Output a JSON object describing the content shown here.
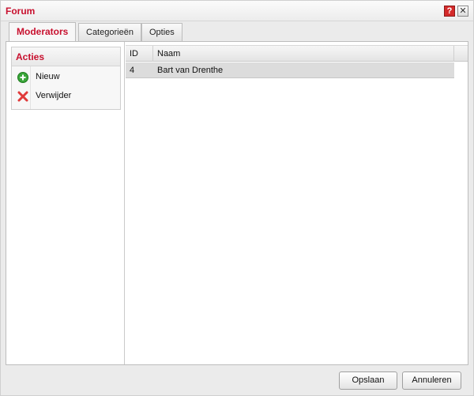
{
  "window": {
    "title": "Forum"
  },
  "titlebar": {
    "help_glyph": "?",
    "close_glyph": "✕"
  },
  "tabs": [
    {
      "label": "Moderators",
      "active": true
    },
    {
      "label": "Categorieën",
      "active": false
    },
    {
      "label": "Opties",
      "active": false
    }
  ],
  "sidebar": {
    "heading": "Acties",
    "items": [
      {
        "label": "Nieuw",
        "icon": "add-icon"
      },
      {
        "label": "Verwijder",
        "icon": "delete-icon"
      }
    ]
  },
  "grid": {
    "columns": [
      "ID",
      "Naam"
    ],
    "rows": [
      {
        "id": "4",
        "name": "Bart van Drenthe"
      }
    ]
  },
  "footer": {
    "save_label": "Opslaan",
    "cancel_label": "Annuleren"
  },
  "colors": {
    "accent": "#c8102e",
    "selected_row": "#dcdcdc",
    "add_icon": "#3aa63a",
    "delete_icon": "#e03a3a"
  }
}
